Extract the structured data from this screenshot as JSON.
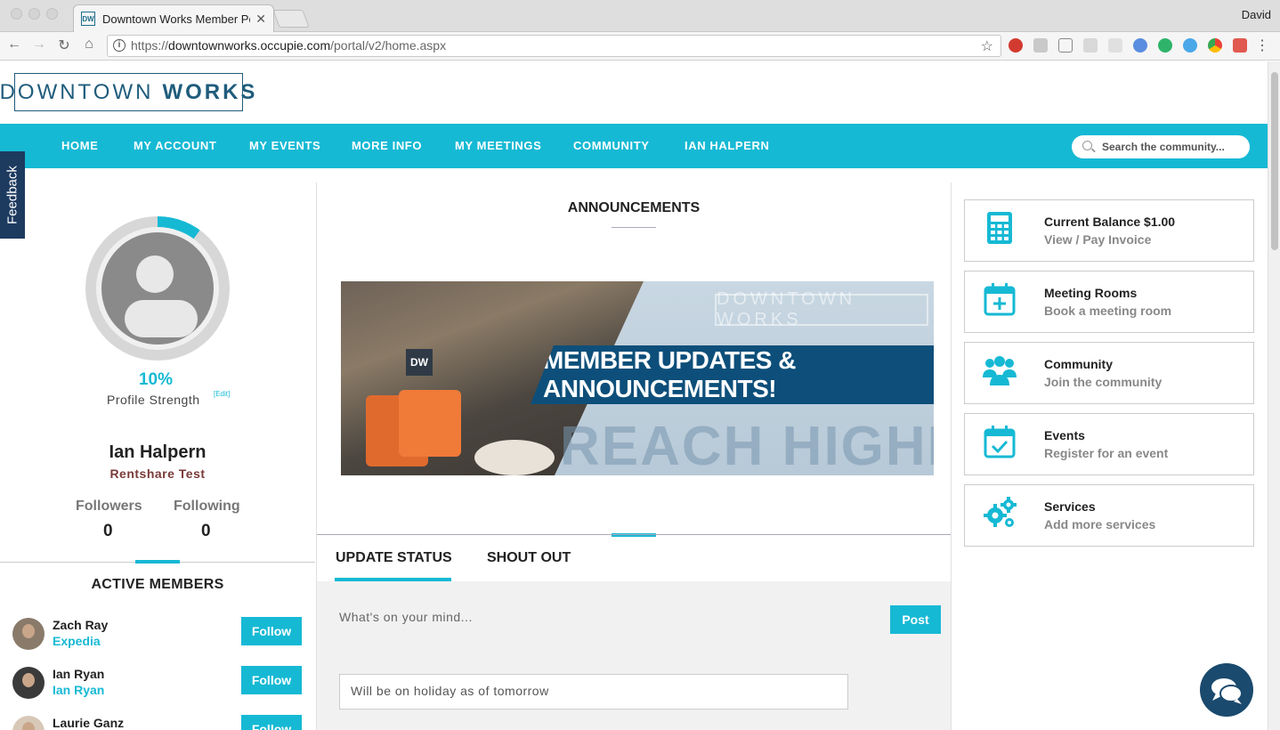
{
  "browser": {
    "tab_title": "Downtown Works Member Por",
    "tab_favicon": "DW",
    "user_name": "David",
    "url_prefix": "https://",
    "url_host": "downtownworks.occupie.com",
    "url_path": "/portal/v2/home.aspx"
  },
  "site": {
    "logo_light": "DOWNTOWN",
    "logo_bold": "WORKS",
    "brand_color": "#16b9d4",
    "nav": [
      "HOME",
      "MY ACCOUNT",
      "MY EVENTS",
      "MORE INFO",
      "MY MEETINGS",
      "COMMUNITY",
      "IAN HALPERN"
    ],
    "search_placeholder": "Search the community...",
    "feedback_label": "Feedback"
  },
  "profile": {
    "strength_percent": "10%",
    "strength_fraction": 0.1,
    "strength_label": "Profile Strength",
    "edit_label": "[Edit]",
    "name": "Ian Halpern",
    "company": "Rentshare Test",
    "followers_label": "Followers",
    "followers": "0",
    "following_label": "Following",
    "following": "0"
  },
  "active_members": {
    "title": "ACTIVE MEMBERS",
    "members": [
      {
        "name": "Zach Ray",
        "company": "Expedia",
        "button": "Follow"
      },
      {
        "name": "Ian Ryan",
        "company": "Ian Ryan",
        "button": "Follow"
      },
      {
        "name": "Laurie Ganz",
        "company": "",
        "button": "Follow"
      }
    ]
  },
  "announcements": {
    "title": "ANNOUNCEMENTS",
    "banner_watermark": "DOWNTOWN WORKS",
    "banner_sign": "DW",
    "banner_headline": "MEMBER UPDATES & ANNOUNCEMENTS!",
    "banner_tagline": "REACH HIGHER"
  },
  "status": {
    "tab_update": "UPDATE STATUS",
    "tab_shout": "SHOUT OUT",
    "placeholder": "What's on your mind...",
    "post_label": "Post",
    "current_status": "Will be on holiday as of tomorrow"
  },
  "quick_links": [
    {
      "title": "Current Balance $1.00",
      "subtitle": "View / Pay Invoice",
      "icon": "calculator-icon"
    },
    {
      "title": "Meeting Rooms",
      "subtitle": "Book a meeting room",
      "icon": "calendar-plus-icon"
    },
    {
      "title": "Community",
      "subtitle": "Join the community",
      "icon": "users-icon"
    },
    {
      "title": "Events",
      "subtitle": "Register for an event",
      "icon": "calendar-check-icon"
    },
    {
      "title": "Services",
      "subtitle": "Add more services",
      "icon": "gears-icon"
    }
  ]
}
